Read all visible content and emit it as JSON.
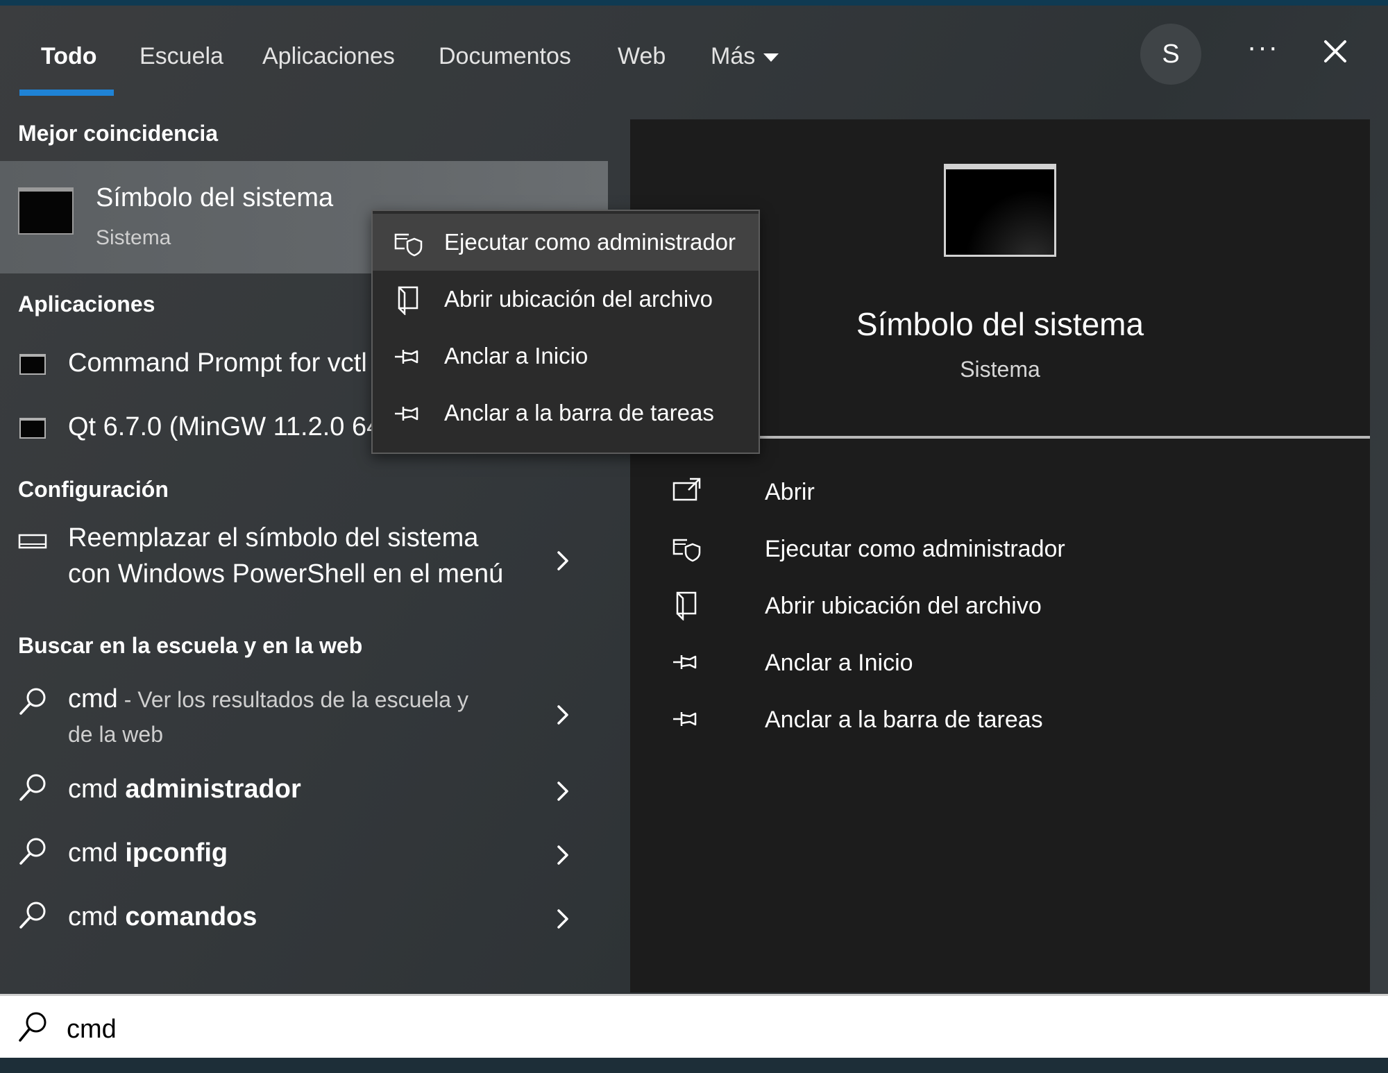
{
  "tabs": [
    {
      "label": "Todo"
    },
    {
      "label": "Escuela"
    },
    {
      "label": "Aplicaciones"
    },
    {
      "label": "Documentos"
    },
    {
      "label": "Web"
    },
    {
      "label": "Más"
    }
  ],
  "header": {
    "avatar_letter": "S",
    "more_glyph": "···"
  },
  "sections": {
    "best_match": "Mejor coincidencia",
    "apps": "Aplicaciones",
    "settings": "Configuración",
    "web": "Buscar en la escuela y en la web"
  },
  "best_match": {
    "title": "Símbolo del sistema",
    "subtitle": "Sistema"
  },
  "apps": [
    {
      "label": "Command Prompt for vctl"
    },
    {
      "label": "Qt 6.7.0 (MinGW 11.2.0 64-bit)"
    }
  ],
  "settings_item": {
    "line1": "Reemplazar el símbolo del sistema",
    "line2": "con Windows PowerShell en el menú"
  },
  "web_results": [
    {
      "prefix": "cmd",
      "rest": " - Ver los resultados de la escuela y",
      "line2": "de la web"
    },
    {
      "prefix": "cmd ",
      "bold": "administrador"
    },
    {
      "prefix": "cmd ",
      "bold": "ipconfig"
    },
    {
      "prefix": "cmd ",
      "bold": "comandos"
    }
  ],
  "context_menu": [
    {
      "label": "Ejecutar como administrador",
      "icon": "shield-window-icon"
    },
    {
      "label": "Abrir ubicación del archivo",
      "icon": "folder-location-icon"
    },
    {
      "label": "Anclar a Inicio",
      "icon": "pin-icon"
    },
    {
      "label": "Anclar a la barra de tareas",
      "icon": "pin-icon"
    }
  ],
  "detail": {
    "title": "Símbolo del sistema",
    "subtitle": "Sistema",
    "actions": [
      {
        "label": "Abrir",
        "icon": "open-icon"
      },
      {
        "label": "Ejecutar como administrador",
        "icon": "shield-window-icon"
      },
      {
        "label": "Abrir ubicación del archivo",
        "icon": "folder-location-icon"
      },
      {
        "label": "Anclar a Inicio",
        "icon": "pin-icon"
      },
      {
        "label": "Anclar a la barra de tareas",
        "icon": "pin-icon"
      }
    ]
  },
  "search": {
    "value": "cmd"
  },
  "colors": {
    "accent": "#1f83d6",
    "panel": "#1c1c1c",
    "highlight": "#63676a"
  }
}
